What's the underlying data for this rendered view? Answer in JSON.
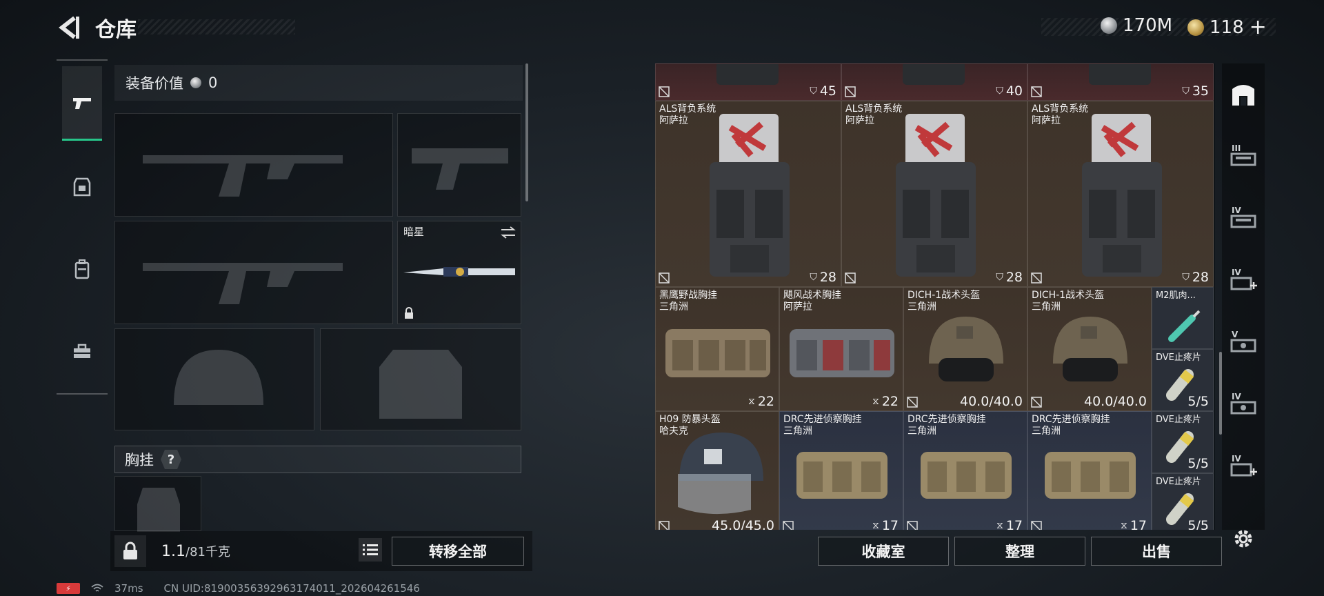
{
  "header": {
    "title": "仓库",
    "currencies": [
      {
        "icon": "silver-coin-icon",
        "value": "170M"
      },
      {
        "icon": "gold-coin-icon",
        "value": "118",
        "suffix": "+"
      }
    ]
  },
  "left_tabs": [
    {
      "name": "weapon",
      "icon": "pistol-icon",
      "active": true
    },
    {
      "name": "armor",
      "icon": "armor-icon",
      "active": false
    },
    {
      "name": "backpack",
      "icon": "backpack-icon",
      "active": false
    },
    {
      "name": "toolbox",
      "icon": "toolbox-icon",
      "active": false
    }
  ],
  "loadout": {
    "equip_value_label": "装备价值",
    "equip_value": "0",
    "melee_slot_name": "暗星",
    "chest_rig_label": "胸挂",
    "chest_rig_help": "?"
  },
  "footer": {
    "weight_current": "1.1",
    "weight_capacity": "/81千克",
    "transfer_all": "转移全部",
    "collection": "收藏室",
    "organize": "整理",
    "sell": "出售"
  },
  "status_bar": {
    "battery": "⚡",
    "ping": "37ms",
    "uid": "CN UID:81900356392963174011_202604261546"
  },
  "stash": {
    "top_row": [
      {
        "count": "45"
      },
      {
        "count": "40"
      },
      {
        "count": "35"
      }
    ],
    "backpacks": [
      {
        "name": "ALS背负系统",
        "maker": "阿萨拉",
        "count": "28"
      },
      {
        "name": "ALS背负系统",
        "maker": "阿萨拉",
        "count": "28"
      },
      {
        "name": "ALS背负系统",
        "maker": "阿萨拉",
        "count": "28"
      }
    ],
    "row3": [
      {
        "name": "黑鹰野战胸挂",
        "maker": "三角洲",
        "value": "22",
        "kind": "rig"
      },
      {
        "name": "飓风战术胸挂",
        "maker": "阿萨拉",
        "value": "22",
        "kind": "rig"
      },
      {
        "name": "DICH-1战术头盔",
        "maker": "三角洲",
        "value": "40.0/40.0",
        "kind": "helmet"
      },
      {
        "name": "DICH-1战术头盔",
        "maker": "三角洲",
        "value": "40.0/40.0",
        "kind": "helmet"
      }
    ],
    "row4": [
      {
        "name": "H09 防暴头盔",
        "maker": "哈夫克",
        "value": "45.0/45.0"
      },
      {
        "name": "DRC先进侦察胸挂",
        "maker": "三角洲",
        "value": "17"
      },
      {
        "name": "DRC先进侦察胸挂",
        "maker": "三角洲",
        "value": "17"
      },
      {
        "name": "DRC先进侦察胸挂",
        "maker": "三角洲",
        "value": "17"
      }
    ],
    "meds": [
      {
        "name": "M2肌肉...",
        "value": ""
      },
      {
        "name": "DVE止疼片",
        "value": "5/5"
      },
      {
        "name": "DVE止疼片",
        "value": "5/5"
      },
      {
        "name": "DVE止疼片",
        "value": "5/5"
      }
    ]
  },
  "right_rail": [
    {
      "icon": "stash-home-icon",
      "label": ""
    },
    {
      "icon": "stash-tier-icon",
      "label": "III"
    },
    {
      "icon": "stash-tier-icon",
      "label": "IV"
    },
    {
      "icon": "stash-tier-add-icon",
      "label": "IV"
    },
    {
      "icon": "stash-tier-icon",
      "label": "V"
    },
    {
      "icon": "stash-tier-icon",
      "label": "IV"
    },
    {
      "icon": "stash-tier-add-icon",
      "label": "IV"
    },
    {
      "icon": "settings-icon",
      "label": ""
    }
  ],
  "colors": {
    "accent": "#27c68a",
    "red_rarity": "#4a2a2c",
    "brown_rarity": "#43382e",
    "blue_rarity": "#333a4a"
  }
}
